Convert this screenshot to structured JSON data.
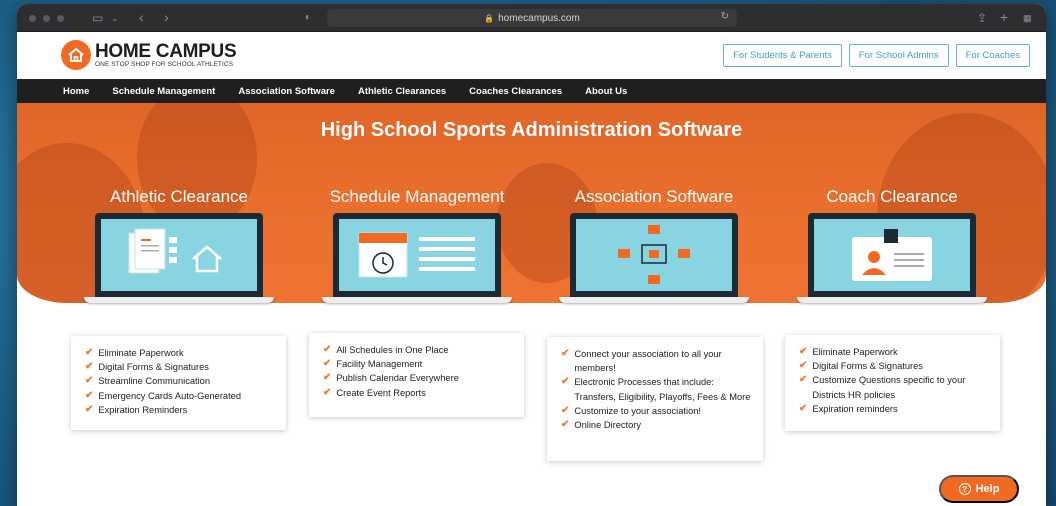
{
  "browser": {
    "url": "homecampus.com"
  },
  "site": {
    "logo_name": "HOME CAMPUS",
    "logo_tagline": "ONE STOP SHOP FOR SCHOOL ATHLETICS",
    "header_buttons": [
      "For Students & Parents",
      "For School Admins",
      "For Coaches"
    ]
  },
  "nav": {
    "items": [
      "Home",
      "Schedule Management",
      "Association Software",
      "Athletic Clearances",
      "Coaches Clearances",
      "About Us"
    ]
  },
  "hero": {
    "title": "High School Sports Administration Software"
  },
  "products": [
    {
      "title": "Athletic Clearance",
      "features": [
        "Eliminate Paperwork",
        "Digital Forms & Signatures",
        "Streamline Communication",
        "Emergency Cards Auto-Generated",
        "Expiration Reminders"
      ]
    },
    {
      "title": "Schedule Management",
      "features": [
        "All Schedules in One Place",
        "Facility Management",
        "Publish Calendar Everywhere",
        "Create Event Reports"
      ]
    },
    {
      "title": "Association Software",
      "features": [
        "Connect your association to all your members!",
        "Electronic Processes that include: Transfers, Eligibility, Playoffs, Fees & More",
        "Customize to your association!",
        "Online Directory"
      ]
    },
    {
      "title": "Coach Clearance",
      "features": [
        "Eliminate Paperwork",
        "Digital Forms & Signatures",
        "Customize Questions specific to your Districts HR policies",
        "Expiration reminders"
      ]
    }
  ],
  "help": {
    "label": "Help"
  },
  "colors": {
    "brand_orange": "#f26a21",
    "nav_dark": "#1f1f22",
    "accent_blue": "#3aa0c8"
  }
}
